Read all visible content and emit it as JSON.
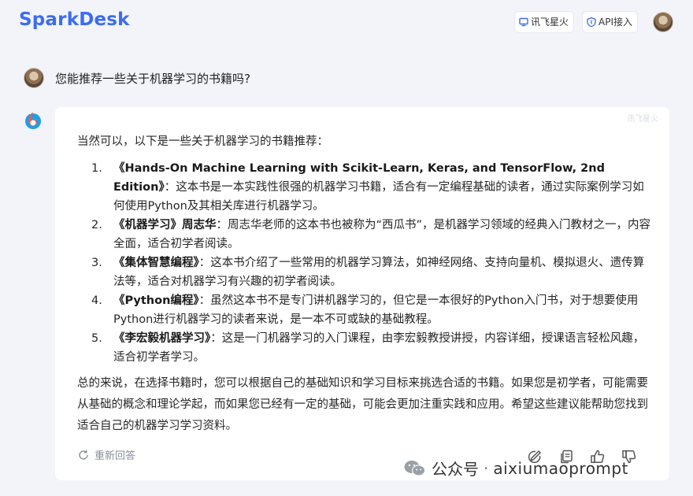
{
  "header": {
    "logo": "SparkDesk",
    "buttons": [
      {
        "label": "讯飞星火",
        "icon": "monitor-icon"
      },
      {
        "label": "API接入",
        "icon": "api-shield-icon"
      }
    ]
  },
  "conversation": {
    "user_question": "您能推荐一些关于机器学习的书籍吗?",
    "answer": {
      "watermark": "讯飞星火",
      "intro": "当然可以，以下是一些关于机器学习的书籍推荐：",
      "books": [
        {
          "num": "1.",
          "title": "《Hands-On Machine Learning with Scikit-Learn, Keras, and TensorFlow, 2nd Edition》",
          "desc": "：这本书是一本实践性很强的机器学习书籍，适合有一定编程基础的读者，通过实际案例学习如何使用Python及其相关库进行机器学习。"
        },
        {
          "num": "2.",
          "title": "《机器学习》周志华",
          "desc": "：周志华老师的这本书也被称为“西瓜书”，是机器学习领域的经典入门教材之一，内容全面，适合初学者阅读。"
        },
        {
          "num": "3.",
          "title": "《集体智慧编程》",
          "desc": "：这本书介绍了一些常用的机器学习算法，如神经网络、支持向量机、模拟退火、遗传算法等，适合对机器学习有兴趣的初学者阅读。"
        },
        {
          "num": "4.",
          "title": "《Python编程》",
          "desc": "：虽然这本书不是专门讲机器学习的，但它是一本很好的Python入门书，对于想要使用Python进行机器学习的读者来说，是一本不可或缺的基础教程。"
        },
        {
          "num": "5.",
          "title": "《李宏毅机器学习》",
          "desc": "：这是一门机器学习的入门课程，由李宏毅教授讲授，内容详细，授课语言轻松风趣，适合初学者学习。"
        }
      ],
      "summary": "总的来说，在选择书籍时，您可以根据自己的基础知识和学习目标来挑选合适的书籍。如果您是初学者，可能需要从基础的概念和理论学起，而如果您已经有一定的基础，可能会更加注重实践和应用。希望这些建议能帮助您找到适合自己的机器学习学习资料。",
      "regenerate_label": "重新回答"
    }
  },
  "overlay": {
    "wechat_label": "公众号",
    "separator": "·",
    "account": "aixiumaoprompt"
  }
}
